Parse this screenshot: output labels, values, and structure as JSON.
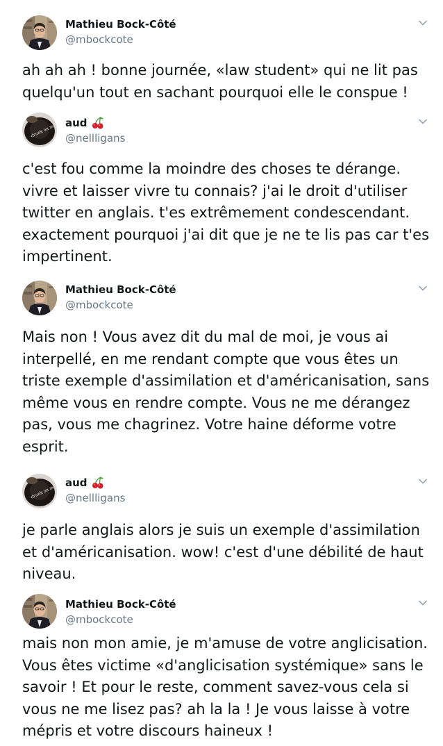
{
  "tweets": [
    {
      "author": "Mathieu Bock-Côté",
      "handle": "@mbockcote",
      "avatar_icon": "user-photo-icon",
      "emoji": "",
      "text": "ah ah ah ! bonne journée, «law student» qui ne lit pas quelqu'un tout en sachant pourquoi elle le conspue !"
    },
    {
      "author": "aud",
      "handle": "@nellligans",
      "avatar_icon": "user-photo-icon",
      "emoji": "cherries-icon",
      "text": "c'est fou comme la moindre des choses te dérange. vivre et laisser vivre tu connais? j'ai le droit d'utiliser twitter en anglais. t'es extrêmement condescendant. exactement pourquoi j'ai dit que je ne te lis pas car t'es impertinent."
    },
    {
      "author": "Mathieu Bock-Côté",
      "handle": "@mbockcote",
      "avatar_icon": "user-photo-icon",
      "emoji": "",
      "text": "Mais non ! Vous avez dit du mal de moi, je vous ai interpellé, en me rendant compte que vous êtes un triste exemple d'assimilation et d'américanisation, sans même vous en rendre compte. Vous ne me dérangez pas, vous me chagrinez. Votre haine déforme votre esprit."
    },
    {
      "author": "aud",
      "handle": "@nellligans",
      "avatar_icon": "user-photo-icon",
      "emoji": "cherries-icon",
      "text": "je parle anglais alors je suis un exemple d'assimilation et d'américanisation. wow! c'est d'une débilité de haut niveau."
    },
    {
      "author": "Mathieu Bock-Côté",
      "handle": "@mbockcote",
      "avatar_icon": "user-photo-icon",
      "emoji": "",
      "text": "mais non mon amie, je m'amuse de votre anglicisation. Vous êtes victime «d'anglicisation systémique» sans le savoir ! Et pour le reste, comment savez-vous cela si vous ne me lisez pas? ah la la ! Je vous laisse à votre mépris et votre discours haineux !"
    }
  ],
  "colors": {
    "text": "#14171a",
    "secondary": "#657786",
    "cherry_red": "#d4202b",
    "stem_green": "#4a9a2e"
  }
}
